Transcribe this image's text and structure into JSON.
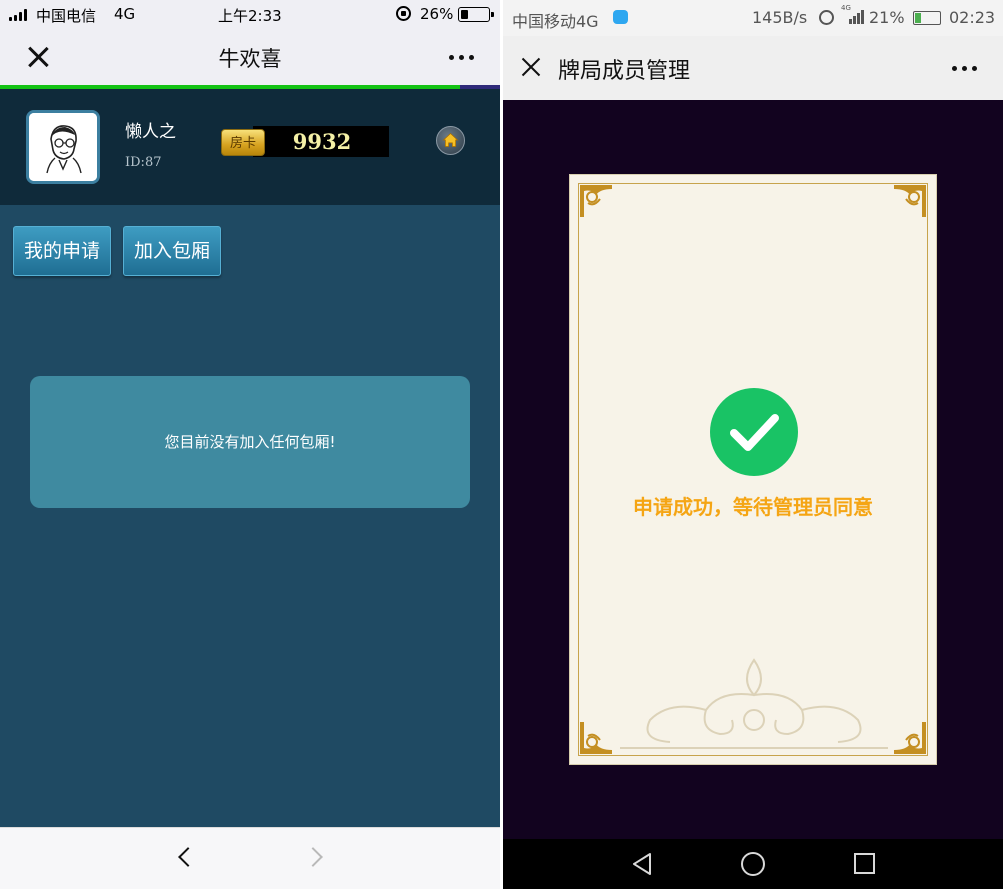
{
  "left_phone": {
    "status_bar": {
      "carrier": "中国电信",
      "network": "4G",
      "time": "上午2:33",
      "battery_pct": "26%",
      "battery_level": 0.26
    },
    "nav": {
      "title": "牛欢喜"
    },
    "page_load_progress": 0.92,
    "profile": {
      "username": "懒人之",
      "user_id": "ID:87",
      "room_card_label": "房卡",
      "room_card_count": "9932"
    },
    "buttons": {
      "my_applications": "我的申请",
      "join_room": "加入包厢"
    },
    "empty_message": "您目前没有加入任何包厢!",
    "icons": [
      "close-icon",
      "more-icon",
      "home-icon",
      "back-chevron-icon",
      "forward-chevron-icon"
    ],
    "colors": {
      "page_bg": "#1f4a63",
      "header_bg": "#0f2a3a",
      "button": "#2a86ad",
      "empty_box": "#3f8aa0",
      "progress": "#14c314",
      "card_number": "#f4f0a6"
    }
  },
  "right_phone": {
    "status_bar": {
      "carrier": "中国移动4G",
      "speed": "145B/s",
      "signal_tag": "4G",
      "battery_pct": "21%",
      "time": "02:23"
    },
    "nav": {
      "title": "牌局成员管理"
    },
    "dialog": {
      "message": "申请成功，等待管理员同意"
    },
    "icons": [
      "close-icon",
      "more-icon",
      "checkmark-icon",
      "back-triangle-icon",
      "home-circle-icon",
      "recents-square-icon"
    ],
    "colors": {
      "page_bg": "#12031f",
      "card_bg": "#f7f3e8",
      "check": "#19c365",
      "message": "#f5a514",
      "frame": "#c7a34b"
    }
  }
}
